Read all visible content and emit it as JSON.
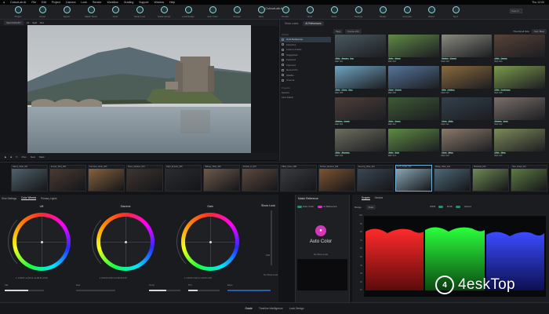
{
  "app": {
    "title": "ColourLab AI"
  },
  "menubar": {
    "items": [
      "ColourLab AI",
      "File",
      "Edit",
      "Project",
      "Camera",
      "Look",
      "Render",
      "Workflow",
      "Grading",
      "Support",
      "Window",
      "Help"
    ],
    "status": "Thu 12:00"
  },
  "toolbar": {
    "items": [
      "Project",
      "Import",
      "Export",
      "Match Shots",
      "Color",
      "Setup Look",
      "Grade Group",
      "Look Design",
      "Auto Color",
      "Scopes",
      "Save",
      "Render",
      "Undo",
      "Redo",
      "Settings",
      "Viewer",
      "Compare",
      "Reset",
      "Sync"
    ],
    "search_placeholder": "Search"
  },
  "viewer": {
    "source_label": "SECONDARY",
    "view_buttons": [
      "Fit",
      "Split",
      "Ref"
    ],
    "transport": [
      "Play",
      "Stop",
      "Loop",
      "Prev",
      "Next",
      "Mark"
    ]
  },
  "reference": {
    "tabs": [
      "Show Looks",
      "AI References"
    ],
    "sidebar": {
      "library_header": "Library",
      "items": [
        "AI AI Reference",
        "Favorites",
        "Custom Folder",
        "Suggested",
        "Featured",
        "Imported",
        "Recent Pro",
        "Wildlife",
        "Cinema"
      ],
      "projects_header": "Projects",
      "projects": [
        "Selects",
        "Shot Match"
      ]
    },
    "grid_header": {
      "filters": [
        "Tags",
        "Frame Info"
      ],
      "sort": "Sort: Best",
      "thumb_label": "Thumbnail Size"
    },
    "thumbs": [
      {
        "caption": "REF 001",
        "tags": [
          "Wide",
          "Exterior",
          "Day"
        ],
        "color": "#4a5960"
      },
      {
        "caption": "REF 002",
        "tags": [
          "Wide",
          "Nature"
        ],
        "color": "#5f8a46"
      },
      {
        "caption": "REF 003",
        "tags": [
          "Medium",
          "Portrait"
        ],
        "color": "#8a8a7e"
      },
      {
        "caption": "REF 004",
        "tags": [
          "Wide",
          "Interior"
        ],
        "color": "#584238"
      },
      {
        "caption": "REF 005",
        "tags": [
          "Wide",
          "Coast",
          "Day"
        ],
        "color": "#6fa4c2"
      },
      {
        "caption": "REF 006",
        "tags": [
          "Close",
          "Portrait"
        ],
        "color": "#55759a"
      },
      {
        "caption": "REF 007",
        "tags": [
          "Wide",
          "Golden"
        ],
        "color": "#8a6a3c"
      },
      {
        "caption": "REF 008",
        "tags": [
          "Wide",
          "Landscape"
        ],
        "color": "#7b9a4c"
      },
      {
        "caption": "REF 009",
        "tags": [
          "Medium",
          "Crowd"
        ],
        "color": "#4e3f3a"
      },
      {
        "caption": "REF 010",
        "tags": [
          "Wide",
          "Forest"
        ],
        "color": "#3e5a34"
      },
      {
        "caption": "REF 011",
        "tags": [
          "Close",
          "Night"
        ],
        "color": "#33404b"
      },
      {
        "caption": "REF 012",
        "tags": [
          "Medium",
          "Dusk"
        ],
        "color": "#7a6f6a"
      },
      {
        "caption": "REF 013",
        "tags": [
          "Wide",
          "Mountain"
        ],
        "color": "#6e6e5e"
      },
      {
        "caption": "REF 014",
        "tags": [
          "Wide",
          "Field"
        ],
        "color": "#5f8b44"
      },
      {
        "caption": "REF 015",
        "tags": [
          "Close",
          "Actor"
        ],
        "color": "#8a7a6a"
      },
      {
        "caption": "REF 016",
        "tags": [
          "Wide",
          "Moor"
        ],
        "color": "#7d8a5a"
      }
    ]
  },
  "filmstrip": {
    "clips": [
      {
        "label": "Nature_Wide_001",
        "color": "#50626b"
      },
      {
        "label": "Interior_Shot_002",
        "color": "#4b3b33"
      },
      {
        "label": "Interview_Close_003",
        "color": "#86623e"
      },
      {
        "label": "Street_Medium_004",
        "color": "#3f3530"
      },
      {
        "label": "Night_Exterior_005",
        "color": "#2a2c31"
      },
      {
        "label": "Hallway_Wide_006",
        "color": "#6d5a4b"
      },
      {
        "label": "Portrait_Lit_007",
        "color": "#5c4a3e"
      },
      {
        "label": "Office_Close_008",
        "color": "#3a3c40"
      },
      {
        "label": "Kitchen_Medium_009",
        "color": "#7e5432"
      },
      {
        "label": "Evening_Wide_010",
        "color": "#3c4753"
      },
      {
        "label": "Loch_Castle_011",
        "color": "#8aa7b6"
      },
      {
        "label": "Bridge_Wide_012",
        "color": "#4e6a78"
      },
      {
        "label": "Moorland_013",
        "color": "#6f8a55"
      },
      {
        "label": "Glen_Road_014",
        "color": "#5e7c45"
      }
    ]
  },
  "color_panel": {
    "tabs": [
      "Shot Settings",
      "Color Wheels",
      "Primary Lights"
    ],
    "wheels": [
      {
        "label": "Lift",
        "values": "L -0.00  R +0.00  G +0.00  B +0.00"
      },
      {
        "label": "Gamma",
        "values": "L 0.00  R 0.00  G 0.00  B 0.00"
      },
      {
        "label": "Gain",
        "values": "L 1.00  R 1.00  G 1.00  B 1.00"
      }
    ],
    "show_look": "Show Look",
    "show_look_value": "100",
    "no_show_look": "No Show Look",
    "bottom_labels": [
      "Sat",
      "Hue",
      "Temp",
      "Tint",
      "Expo",
      "Contrast"
    ]
  },
  "match": {
    "title": "Match Reference",
    "toggles": [
      "Auto Color",
      "Ai Reference"
    ],
    "auto_label": "Auto Color",
    "no_show": "No Show Look"
  },
  "scopes": {
    "tabs": [
      "Scopes",
      "Vectors"
    ],
    "controls": [
      "Range",
      "Dual"
    ],
    "right_controls": [
      "WFM",
      "RGB",
      "Gamut"
    ],
    "yticks": [
      "100",
      "90",
      "80",
      "70",
      "60",
      "50",
      "40",
      "30",
      "20",
      "10"
    ],
    "chart_data": {
      "type": "area",
      "series": [
        {
          "name": "Red",
          "values": [
            0.55,
            0.7,
            0.65,
            0.75,
            0.6
          ]
        },
        {
          "name": "Green",
          "values": [
            0.6,
            0.75,
            0.7,
            0.8,
            0.65
          ]
        },
        {
          "name": "Blue",
          "values": [
            0.5,
            0.65,
            0.6,
            0.7,
            0.55
          ]
        }
      ]
    }
  },
  "bottom_tabs": [
    "Grade",
    "Timeline Intelligence",
    "Look Design"
  ],
  "watermark": {
    "text": "4eskTop"
  }
}
